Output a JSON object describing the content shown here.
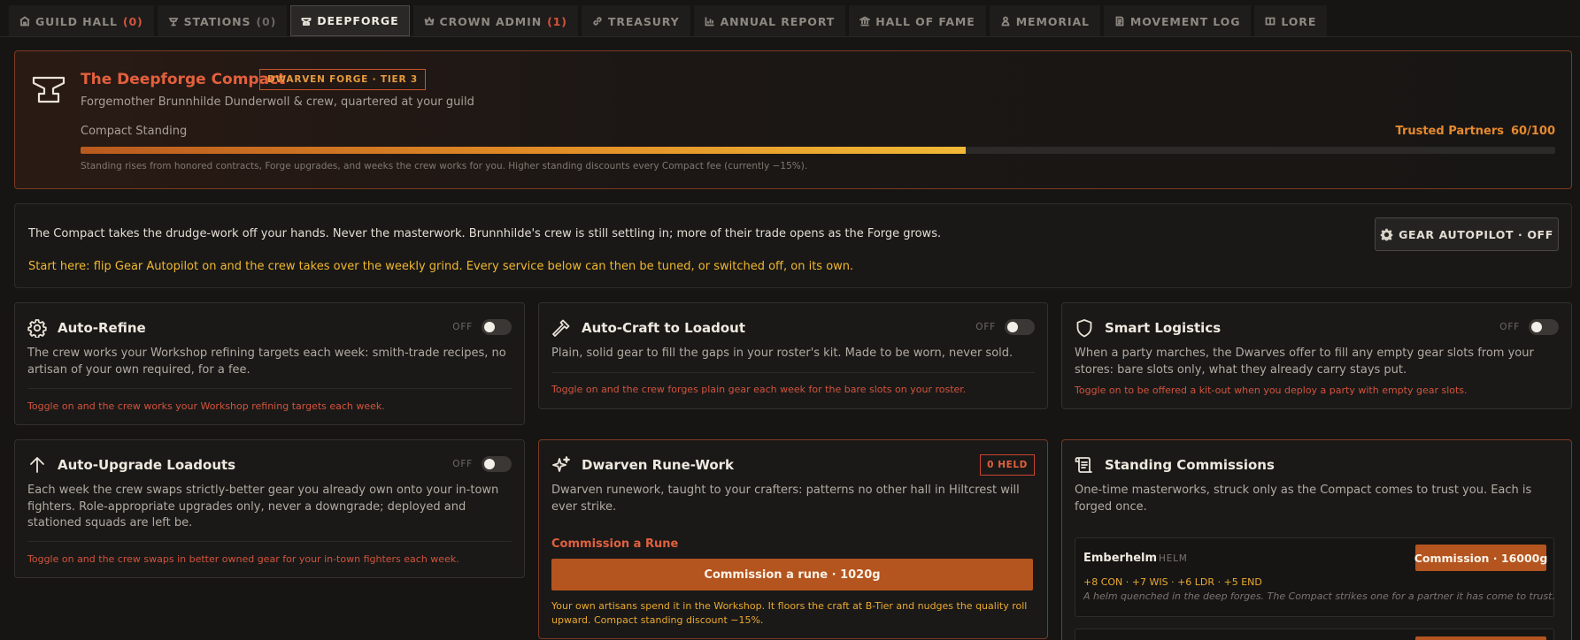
{
  "tabs": [
    {
      "label": "GUILD HALL",
      "count": "(0)",
      "count_style": "red",
      "icon": "guild-hall-icon"
    },
    {
      "label": "STATIONS",
      "count": "(0)",
      "count_style": "gray",
      "icon": "stations-icon"
    },
    {
      "label": "DEEPFORGE",
      "count": "",
      "count_style": "",
      "icon": "anvil-icon",
      "active": true
    },
    {
      "label": "CROWN ADMIN",
      "count": "(1)",
      "count_style": "red",
      "icon": "crown-icon"
    },
    {
      "label": "TREASURY",
      "count": "",
      "count_style": "",
      "icon": "link-icon"
    },
    {
      "label": "ANNUAL REPORT",
      "count": "",
      "count_style": "",
      "icon": "bar-chart-icon"
    },
    {
      "label": "HALL OF FAME",
      "count": "",
      "count_style": "",
      "icon": "pillar-icon"
    },
    {
      "label": "MEMORIAL",
      "count": "",
      "count_style": "",
      "icon": "person-icon"
    },
    {
      "label": "MOVEMENT LOG",
      "count": "",
      "count_style": "",
      "icon": "log-icon"
    },
    {
      "label": "LORE",
      "count": "",
      "count_style": "",
      "icon": "book-icon"
    }
  ],
  "header": {
    "title": "The Deepforge Compact",
    "tier_badge": "DWARVEN FORGE · TIER 3",
    "subtitle": "Forgemother Brunnhilde Dunderwoll & crew, quartered at your guild",
    "standing_label": "Compact Standing",
    "standing_rank": "Trusted Partners",
    "standing_value": "60/100",
    "standing_fraction": 0.6,
    "standing_note": "Standing rises from honored contracts, Forge upgrades, and weeks the crew works for you. Higher standing discounts every Compact fee (currently −15%)."
  },
  "intro": {
    "line1": "The Compact takes the drudge-work off your hands. Never the masterwork. Brunnhilde's crew is still settling in; more of their trade opens as the Forge grows.",
    "line2": "Start here: flip Gear Autopilot on and the crew takes over the weekly grind. Every service below can then be tuned, or switched off, on its own.",
    "autopilot_button": "GEAR AUTOPILOT · OFF"
  },
  "cards": {
    "auto_refine": {
      "title": "Auto-Refine",
      "toggle_label": "OFF",
      "description": "The crew works your Workshop refining targets each week: smith-trade recipes, no artisan of your own required, for a fee.",
      "hint": "Toggle on and the crew works your Workshop refining targets each week."
    },
    "auto_craft": {
      "title": "Auto-Craft to Loadout",
      "toggle_label": "OFF",
      "description": "Plain, solid gear to fill the gaps in your roster's kit. Made to be worn, never sold.",
      "hint": "Toggle on and the crew forges plain gear each week for the bare slots on your roster."
    },
    "smart_logistics": {
      "title": "Smart Logistics",
      "toggle_label": "OFF",
      "description": "When a party marches, the Dwarves offer to fill any empty gear slots from your stores: bare slots only, what they already carry stays put.",
      "hint": "Toggle on to be offered a kit-out when you deploy a party with empty gear slots."
    },
    "auto_upgrade": {
      "title": "Auto-Upgrade Loadouts",
      "toggle_label": "OFF",
      "description": "Each week the crew swaps strictly-better gear you already own onto your in-town fighters. Role-appropriate upgrades only, never a downgrade; deployed and stationed squads are left be.",
      "hint": "Toggle on and the crew swaps in better owned gear for your in-town fighters each week."
    },
    "rune_work": {
      "title": "Dwarven Rune-Work",
      "held_badge": "0 HELD",
      "description": "Dwarven runework, taught to your crafters: patterns no other hall in Hiltcrest will ever strike.",
      "section_label": "Commission a Rune",
      "button": "Commission a rune · 1020g",
      "note": "Your own artisans spend it in the Workshop. It floors the craft at B-Tier and nudges the quality roll upward. Compact standing discount −15%."
    },
    "standing_commissions": {
      "title": "Standing Commissions",
      "description": "One-time masterworks, struck only as the Compact comes to trust you. Each is forged once.",
      "items": [
        {
          "name": "Emberhelm",
          "type": "HELM",
          "button": "Commission · 16000g",
          "stats": "+8 CON · +7 WIS · +6 LDR · +5 END",
          "flavor": "A helm quenched in the deep forges. The Compact strikes one for a partner it has come to trust."
        }
      ]
    }
  },
  "colors": {
    "accent": "#e2603d",
    "gold": "#f0b72f",
    "button": "#b4541f",
    "background": "#161514"
  }
}
